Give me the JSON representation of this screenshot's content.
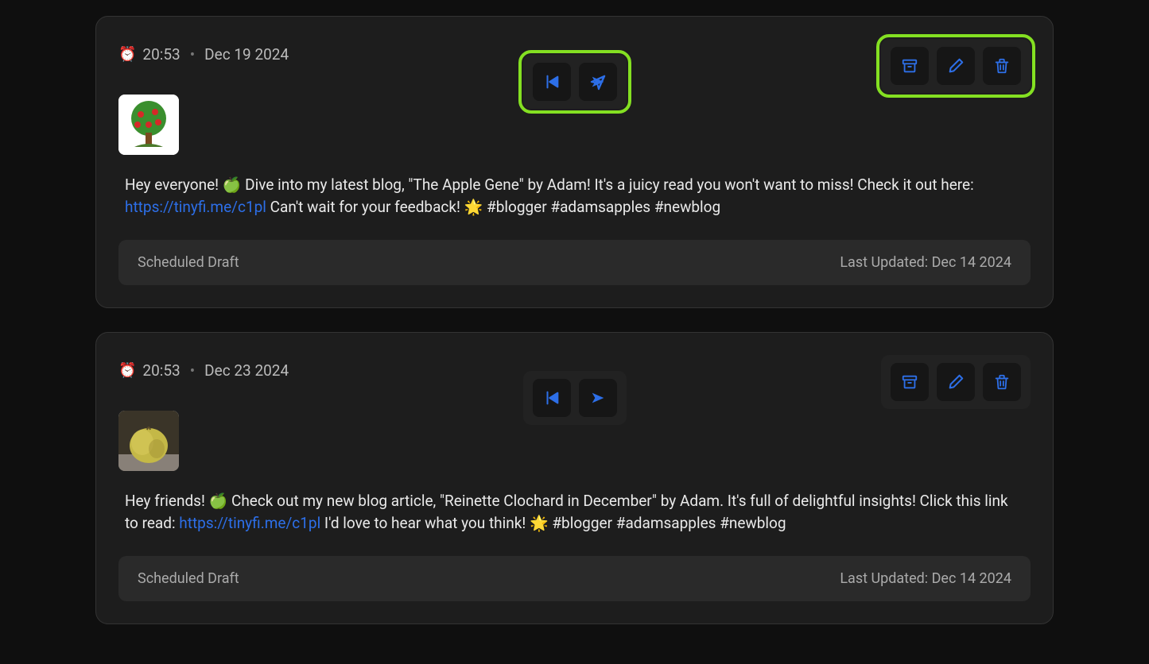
{
  "posts": [
    {
      "clock_emoji": "⏰",
      "time": "20:53",
      "date": "Dec 19 2024",
      "highlight": true,
      "thumb_type": "tree",
      "text_pre": "Hey everyone! 🍏 Dive into my latest blog, \"The Apple Gene\" by Adam! It's a juicy read you won't want to miss! Check it out here: ",
      "link": "https://tinyfi.me/c1pl",
      "text_post": " Can't wait for your feedback! 🌟 #blogger #adamsapples #newblog",
      "status_label": "Scheduled Draft",
      "updated_label": "Last Updated: Dec 14 2024"
    },
    {
      "clock_emoji": "⏰",
      "time": "20:53",
      "date": "Dec 23 2024",
      "highlight": false,
      "thumb_type": "apple",
      "text_pre": "Hey friends! 🍏 Check out my new blog article, \"Reinette Clochard in December\" by Adam. It's full of delightful insights! Click this link to read: ",
      "link": "https://tinyfi.me/c1pl",
      "text_post": " I'd love to hear what you think! 🌟 #blogger #adamsapples #newblog",
      "status_label": "Scheduled Draft",
      "updated_label": "Last Updated: Dec 14 2024"
    }
  ]
}
